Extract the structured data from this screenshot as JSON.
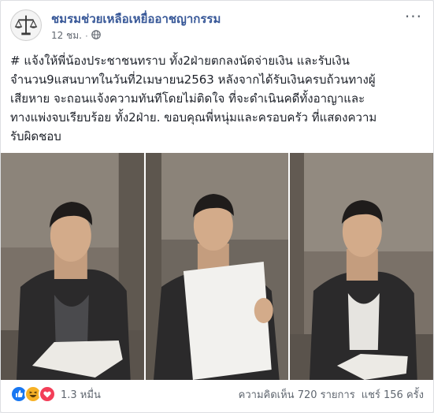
{
  "post": {
    "page_name": "ชมรมช่วยเหลือเหยื่ออาชญากรรม",
    "time": "12 ชม.",
    "text_lines": [
      "# แจ้งให้พี่น้องประชาชนทราบ ทั้ง2ฝ่ายตกลงนัดจ่ายเงิน และรับเงิน",
      "จำนวน9แสนบาทในวันที่2เมษายน2563 หลังจากได้รับเงินครบถ้วนทางผู้",
      "เสียหาย จะถอนแจ้งความทันทีโดยไม่ติดใจ ที่จะดำเนินคดีทั้งอาญาและ",
      "ทางแพ่งจบเรียบร้อย ทั้ง2ฝ่าย. ขอบคุณพี่หนุ่มและครอบครัว ที่แสดงความ",
      "รับผิดชอบ"
    ]
  },
  "icons": {
    "privacy": "globe-icon",
    "more": "more-options-icon",
    "reactions": [
      "like-icon",
      "haha-icon",
      "love-icon"
    ]
  },
  "footer": {
    "reactions_count": "1.3 หมื่น",
    "comments": "ความคิดเห็น 720 รายการ",
    "shares": "แชร์ 156 ครั้ง"
  },
  "colors": {
    "page_name": "#385898",
    "like": "#1877f2",
    "haha": "#f7b125",
    "love": "#f33e58"
  }
}
